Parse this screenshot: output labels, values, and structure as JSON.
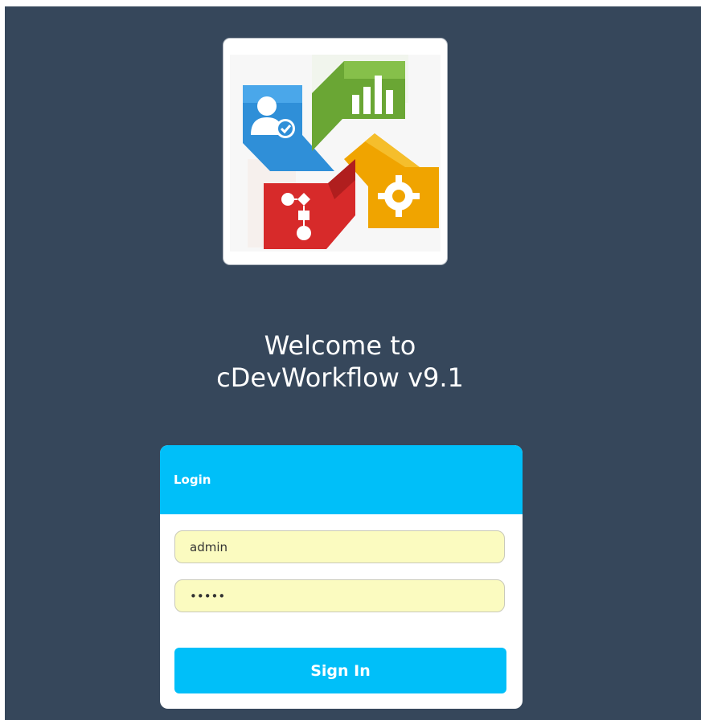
{
  "colors": {
    "background": "#36475b",
    "accent": "#00bff9",
    "field_fill": "#fbfbc0"
  },
  "logo": {
    "icons": [
      "user-check-icon",
      "bar-chart-icon",
      "flowchart-icon",
      "gear-icon"
    ]
  },
  "welcome": {
    "line1": "Welcome to",
    "line2": "cDevWorkflow v9.1"
  },
  "login": {
    "title": "Login",
    "username_value": "admin",
    "password_value": "admin",
    "submit_label": "Sign In"
  }
}
